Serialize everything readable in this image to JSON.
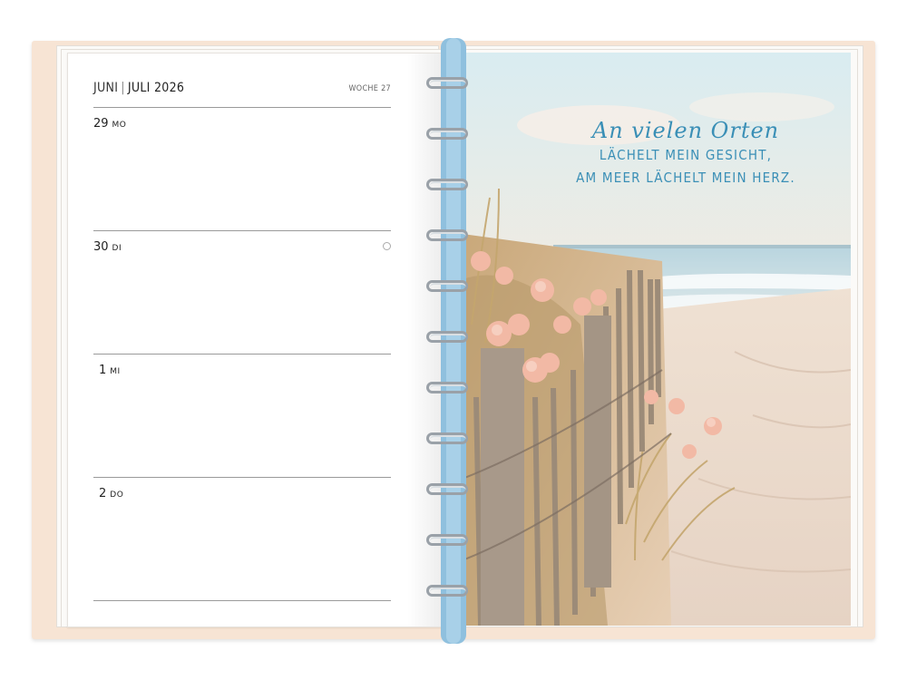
{
  "planner": {
    "header": {
      "month_prev": "JUNI",
      "separator": "|",
      "month_year": "JULI 2026",
      "week": "WOCHE 27"
    },
    "days": [
      {
        "num": "29",
        "weekday": "MO"
      },
      {
        "num": "30",
        "weekday": "DI"
      },
      {
        "num": "1",
        "weekday": "MI"
      },
      {
        "num": "2",
        "weekday": "DO"
      }
    ]
  },
  "quote": {
    "line1": "An vielen Orten",
    "line2": "LÄCHELT MEIN GESICHT,",
    "line3": "AM MEER LÄCHELT MEIN HERZ."
  },
  "colors": {
    "cover": "#f7e4d4",
    "spine": "#8fc0de",
    "quote_text": "#3a8fb6",
    "rings": "#9aa1a8"
  }
}
